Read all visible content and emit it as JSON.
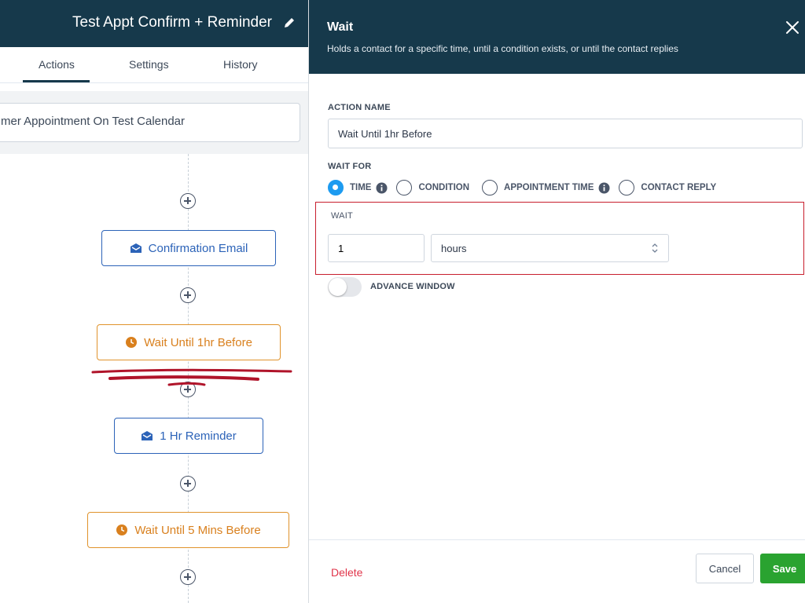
{
  "workflow": {
    "title": "Test Appt Confirm + Reminder",
    "tabs": [
      {
        "label": "Actions",
        "active": true
      },
      {
        "label": "Settings",
        "active": false
      },
      {
        "label": "History",
        "active": false
      }
    ],
    "trigger_label": "mer Appointment On Test Calendar",
    "steps": [
      {
        "type": "email",
        "label": "Confirmation Email",
        "icon": "envelope-open-icon"
      },
      {
        "type": "wait",
        "label": "Wait Until 1hr Before",
        "icon": "clock-icon"
      },
      {
        "type": "email",
        "label": "1 Hr Reminder",
        "icon": "envelope-open-icon"
      },
      {
        "type": "wait",
        "label": "Wait Until 5 Mins Before",
        "icon": "clock-icon"
      }
    ]
  },
  "panel": {
    "title": "Wait",
    "subtitle": "Holds a contact for a specific time, until a condition exists, or until the contact replies",
    "action_name_label": "ACTION NAME",
    "action_name_value": "Wait Until 1hr Before",
    "wait_for_label": "WAIT FOR",
    "wait_for_options": [
      {
        "label": "TIME",
        "checked": true,
        "info": true
      },
      {
        "label": "CONDITION",
        "checked": false,
        "info": false
      },
      {
        "label": "APPOINTMENT TIME",
        "checked": false,
        "info": true
      },
      {
        "label": "CONTACT REPLY",
        "checked": false,
        "info": false
      }
    ],
    "wait_label": "WAIT",
    "wait_amount": "1",
    "wait_unit": "hours",
    "advance_window_label": "ADVANCE WINDOW",
    "advance_window_on": false,
    "delete_label": "Delete",
    "cancel_label": "Cancel",
    "save_label": "Save"
  },
  "colors": {
    "header": "#16394b",
    "email_accent": "#2c63b8",
    "wait_accent": "#e0932c",
    "radio_checked": "#1d9bf0",
    "delete": "#e0344a",
    "save": "#2aa330",
    "highlight_box": "#c81e2d",
    "scribble": "#b0142a"
  }
}
